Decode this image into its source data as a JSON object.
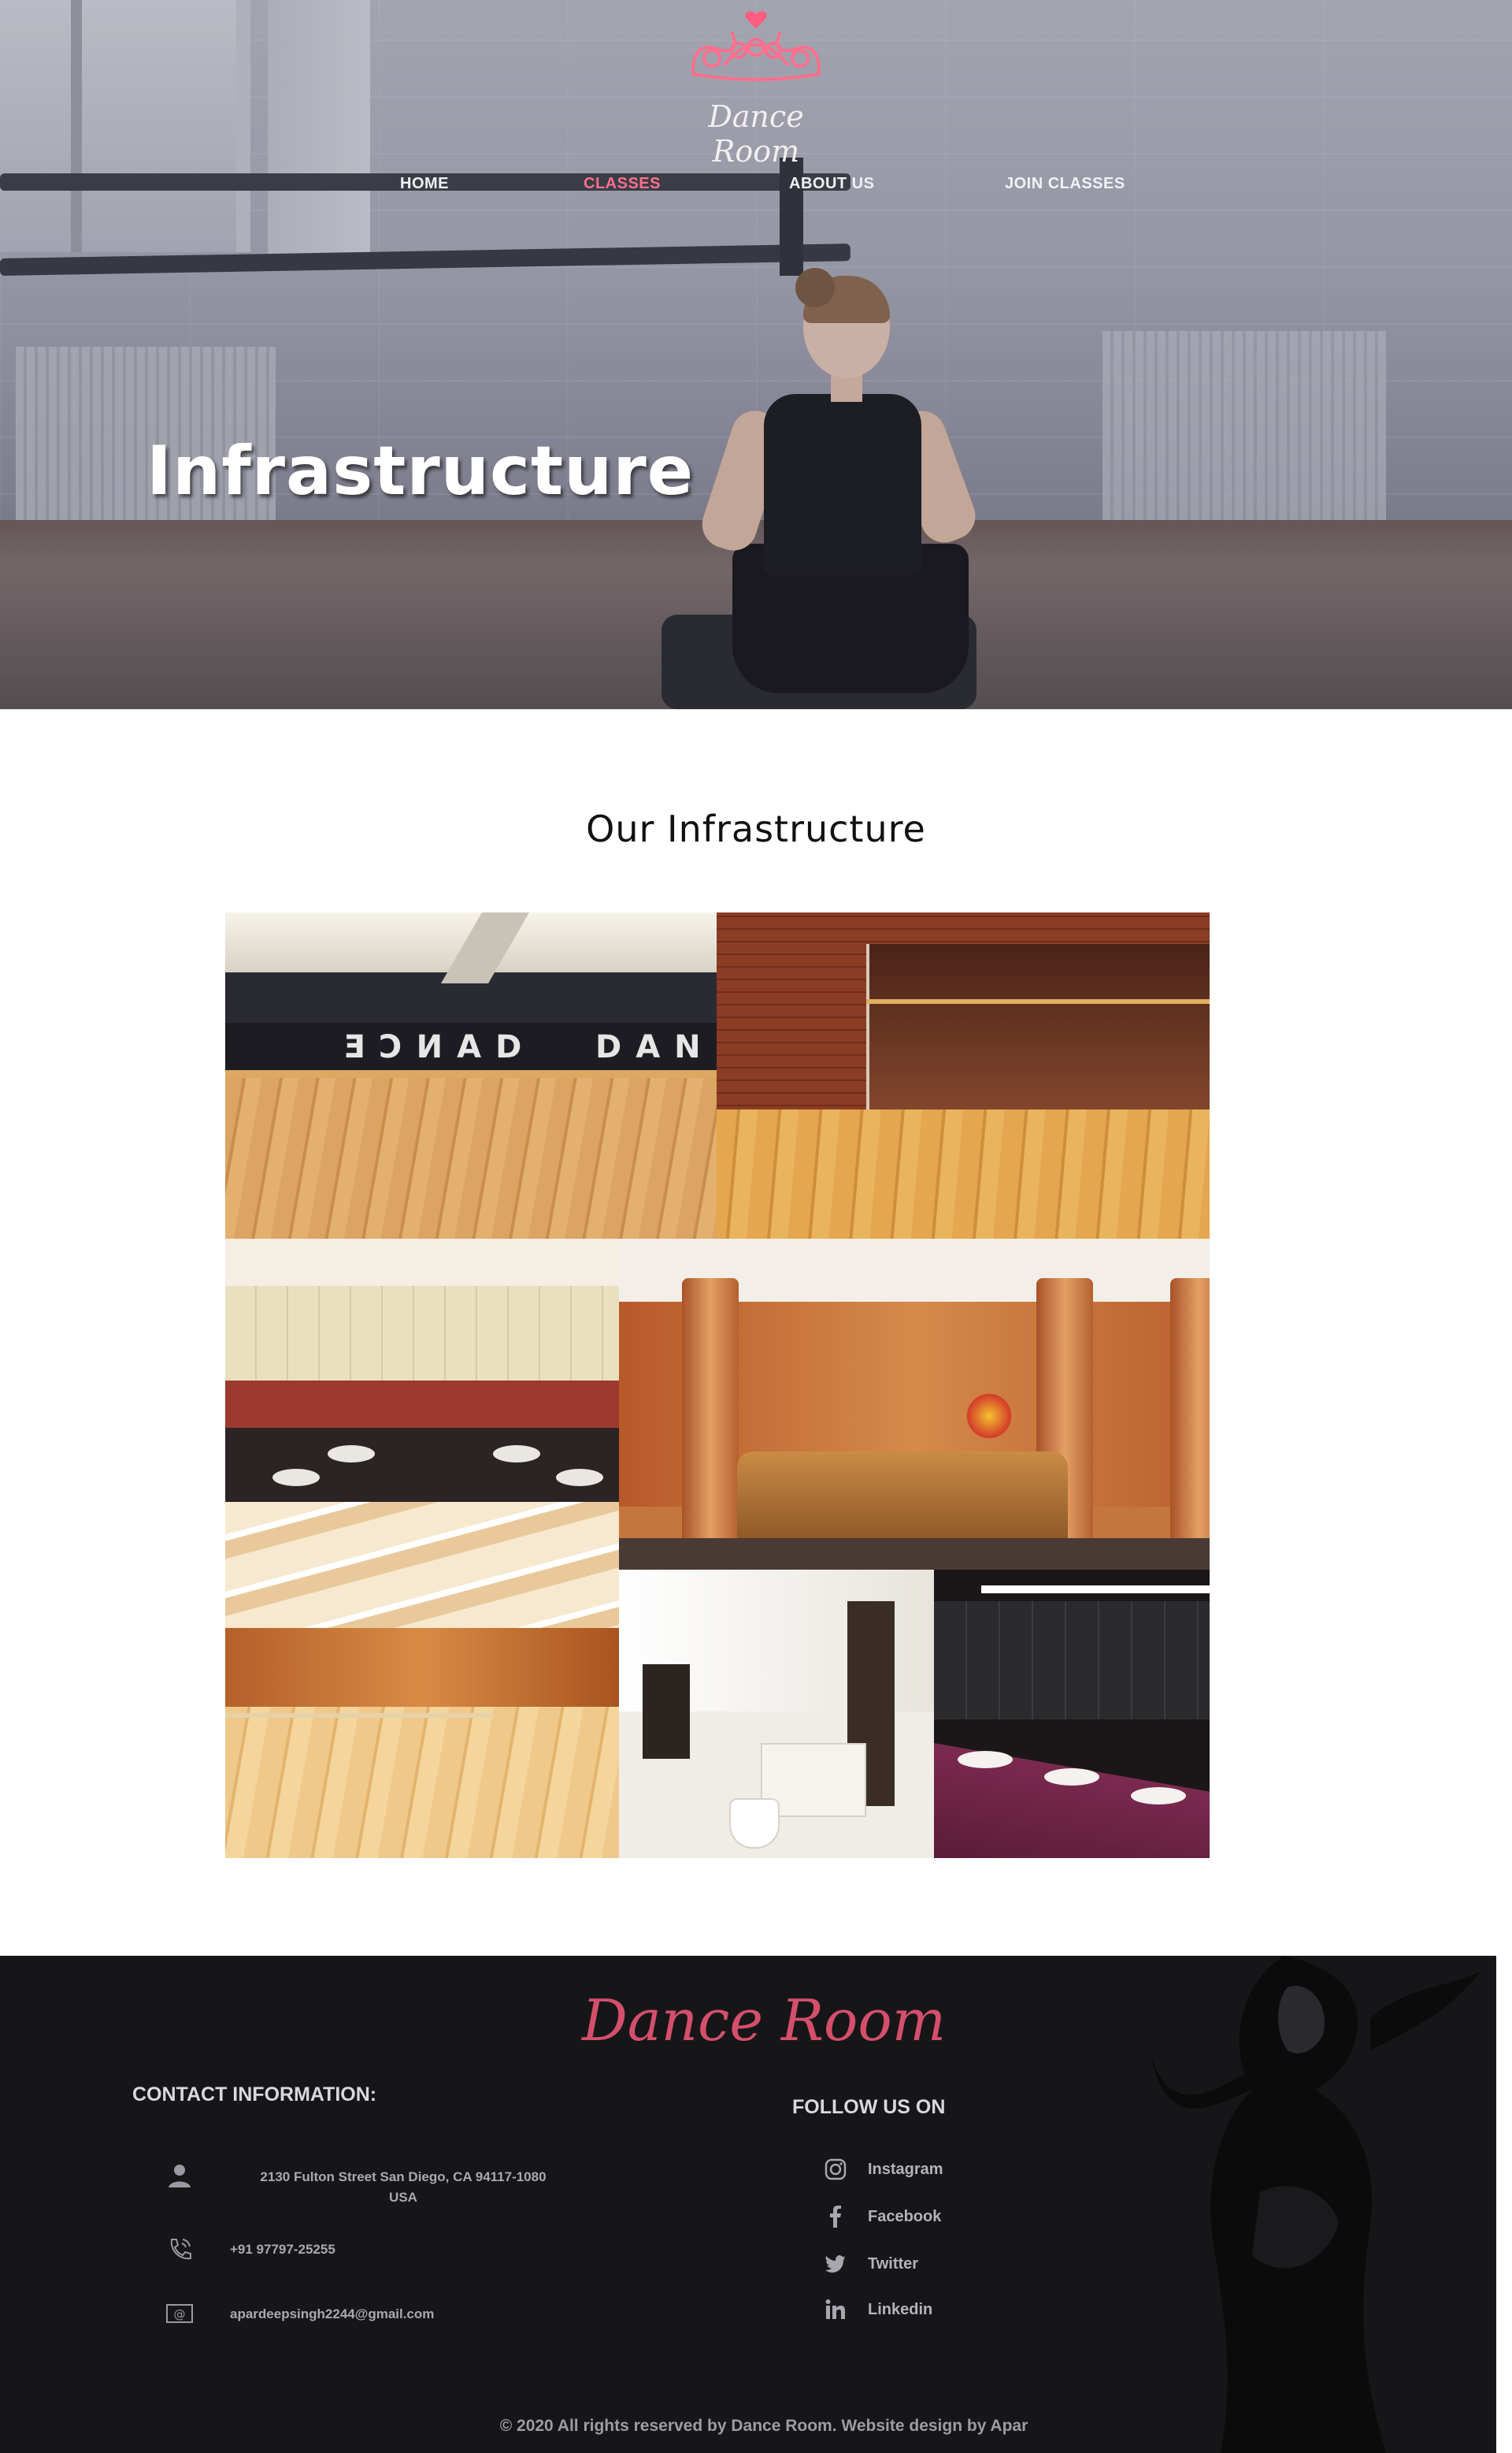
{
  "brand": {
    "name": "Dance Room",
    "accent": "#ff6f8d",
    "footer_accent": "#d44f6c"
  },
  "nav": {
    "items": [
      {
        "label": "HOME",
        "active": false
      },
      {
        "label": "CLASSES",
        "active": true
      },
      {
        "label": "ABOUT US",
        "active": false
      },
      {
        "label": "JOIN CLASSES",
        "active": false
      }
    ]
  },
  "hero": {
    "title": "Infrastructure"
  },
  "section": {
    "title": "Our Infrastructure",
    "gallery": [
      {
        "icon": "dance-studio-photo"
      },
      {
        "icon": "brick-studio-photo"
      },
      {
        "icon": "washroom-photo"
      },
      {
        "icon": "reception-lobby-photo"
      },
      {
        "icon": "orange-studio-photo"
      },
      {
        "icon": "bathroom-photo"
      },
      {
        "icon": "dark-washroom-photo"
      }
    ]
  },
  "footer": {
    "brand": "Dance Room",
    "contact": {
      "heading": "CONTACT INFORMATION:",
      "address_line1": "2130 Fulton Street San Diego, CA 94117-1080",
      "address_line2": "USA",
      "phone": "+91 97797-25255",
      "email": "apardeepsingh2244@gmail.com"
    },
    "social": {
      "heading": "FOLLOW US ON",
      "links": [
        {
          "label": "Instagram",
          "icon": "instagram-icon"
        },
        {
          "label": "Facebook",
          "icon": "facebook-icon"
        },
        {
          "label": "Twitter",
          "icon": "twitter-icon"
        },
        {
          "label": "Linkedin",
          "icon": "linkedin-icon"
        }
      ]
    },
    "copyright": "© 2020 All rights reserved by Dance Room. Website design by Apar"
  }
}
